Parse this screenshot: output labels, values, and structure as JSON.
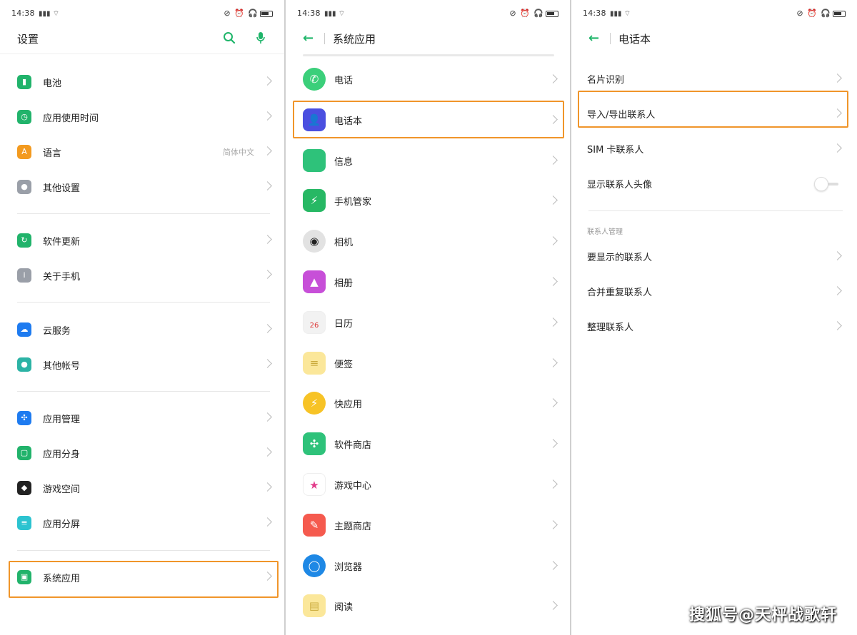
{
  "status": {
    "time": "14:38",
    "right_icons": "⊘ ⏰ 🎧"
  },
  "panel1": {
    "title": "设置",
    "groups": [
      [
        {
          "label": "电池",
          "icon": "battery-icon",
          "color": "#21b36b"
        },
        {
          "label": "应用使用时间",
          "icon": "clock-icon",
          "color": "#21b36b"
        },
        {
          "label": "语言",
          "icon": "language-icon",
          "color": "#f39a1f",
          "value": "简体中文"
        },
        {
          "label": "其他设置",
          "icon": "gear-icon",
          "color": "#9a9fa8"
        }
      ],
      [
        {
          "label": "软件更新",
          "icon": "update-icon",
          "color": "#21b36b"
        },
        {
          "label": "关于手机",
          "icon": "info-icon",
          "color": "#9a9fa8"
        }
      ],
      [
        {
          "label": "云服务",
          "icon": "cloud-icon",
          "color": "#1e7bf0"
        },
        {
          "label": "其他帐号",
          "icon": "account-icon",
          "color": "#2cb3a5"
        }
      ],
      [
        {
          "label": "应用管理",
          "icon": "apps-icon",
          "color": "#1e7bf0"
        },
        {
          "label": "应用分身",
          "icon": "clone-icon",
          "color": "#21b36b"
        },
        {
          "label": "游戏空间",
          "icon": "game-icon",
          "color": "#222222"
        },
        {
          "label": "应用分屏",
          "icon": "split-screen-icon",
          "color": "#2cc3d0"
        }
      ],
      [
        {
          "label": "系统应用",
          "icon": "system-apps-icon",
          "color": "#21b36b"
        }
      ]
    ]
  },
  "panel2": {
    "title": "系统应用",
    "items": [
      {
        "label": "电话",
        "icon": "phone-icon",
        "color": "#3bcf7a"
      },
      {
        "label": "电话本",
        "icon": "contacts-icon",
        "color": "#4a4fe0"
      },
      {
        "label": "信息",
        "icon": "messages-icon",
        "color": "#2ec27a"
      },
      {
        "label": "手机管家",
        "icon": "phone-manager-icon",
        "color": "#27b864"
      },
      {
        "label": "相机",
        "icon": "camera-icon",
        "color": "#e2e2e2"
      },
      {
        "label": "相册",
        "icon": "gallery-icon",
        "color": "#c74fd8"
      },
      {
        "label": "日历",
        "icon": "calendar-icon",
        "color": "#f2f2f2"
      },
      {
        "label": "便签",
        "icon": "notes-icon",
        "color": "#fbe79a"
      },
      {
        "label": "快应用",
        "icon": "quick-app-icon",
        "color": "#f7c326"
      },
      {
        "label": "软件商店",
        "icon": "app-store-icon",
        "color": "#2ec27a"
      },
      {
        "label": "游戏中心",
        "icon": "game-center-icon",
        "color": "#ffffff"
      },
      {
        "label": "主题商店",
        "icon": "theme-store-icon",
        "color": "#f55a4e"
      },
      {
        "label": "浏览器",
        "icon": "browser-icon",
        "color": "#1e88e5"
      },
      {
        "label": "阅读",
        "icon": "reading-icon",
        "color": "#fbe79a"
      }
    ],
    "calendar_day": "26"
  },
  "panel3": {
    "title": "电话本",
    "items_top": [
      {
        "label": "名片识别"
      },
      {
        "label": "导入/导出联系人"
      },
      {
        "label": "SIM 卡联系人"
      }
    ],
    "toggle_row": {
      "label": "显示联系人头像",
      "on": false
    },
    "section_label": "联系人管理",
    "items_bottom": [
      {
        "label": "要显示的联系人"
      },
      {
        "label": "合并重复联系人"
      },
      {
        "label": "整理联系人"
      }
    ]
  },
  "watermark": "搜狐号@天枰战歌轩"
}
